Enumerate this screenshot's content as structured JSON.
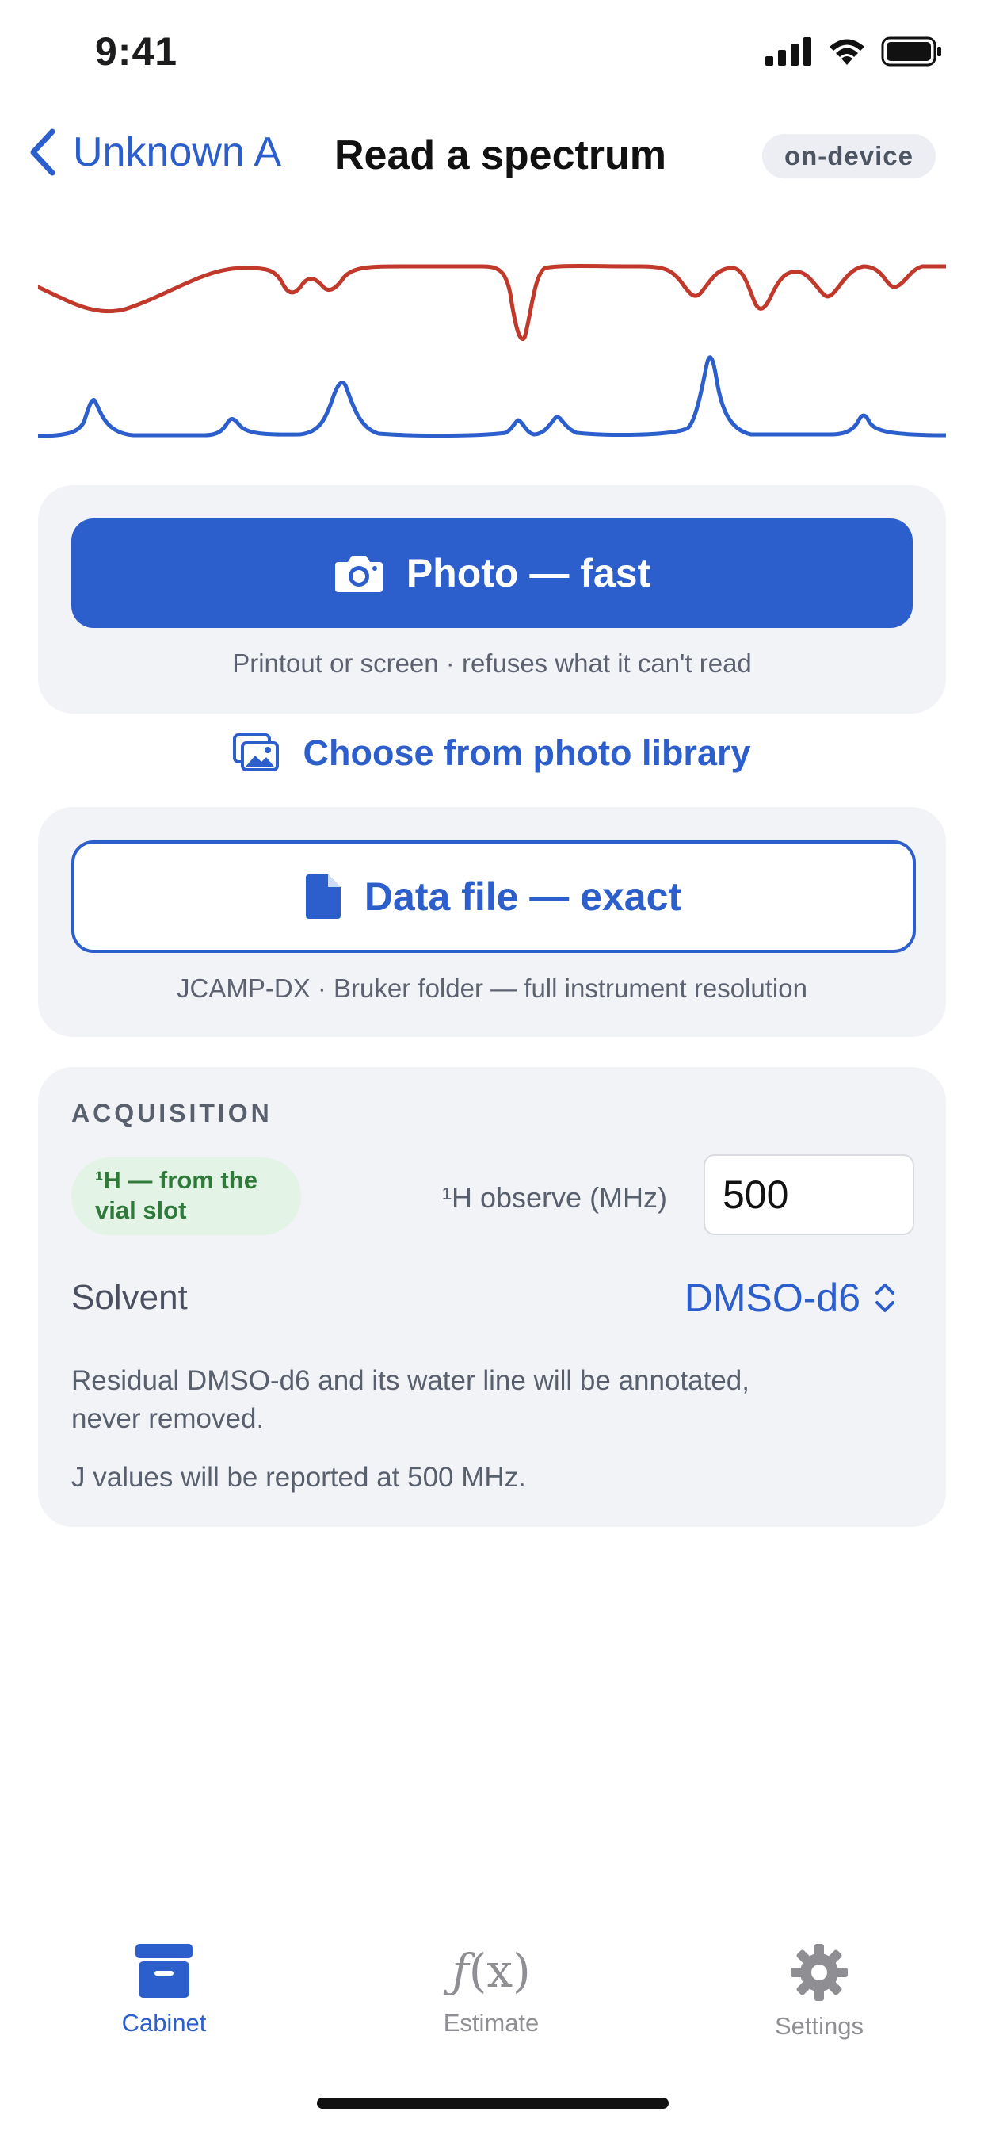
{
  "status_bar": {
    "time": "9:41"
  },
  "nav": {
    "back_label": "Unknown A",
    "title": "Read a spectrum",
    "badge": "on-device"
  },
  "photo_card": {
    "button_label": "Photo — fast",
    "caption": "Printout or screen · refuses what it can't read"
  },
  "library_link": {
    "label": "Choose from photo library"
  },
  "file_card": {
    "button_label": "Data file — exact",
    "caption": "JCAMP-DX · Bruker folder — full instrument resolution"
  },
  "acquisition": {
    "heading": "ACQUISITION",
    "nucleus_pill_line1": "¹H — from the",
    "nucleus_pill_line2": "vial slot",
    "observe_label": "¹H observe (MHz)",
    "observe_value": "500",
    "solvent_label": "Solvent",
    "solvent_value": "DMSO-d6",
    "note_residual_line1": "Residual DMSO-d6 and its water line will be annotated,",
    "note_residual_line2": "never removed.",
    "note_j": "J values will be reported at 500 MHz."
  },
  "tabs": [
    {
      "label": "Cabinet",
      "icon": "archive-box-icon",
      "selected": true
    },
    {
      "label": "Estimate",
      "icon": "function-fx-icon",
      "selected": false
    },
    {
      "label": "Settings",
      "icon": "gear-icon",
      "selected": false
    }
  ],
  "colors": {
    "accent": "#2c5fcc",
    "ir_trace": "#c0392b",
    "nmr_trace": "#2c5fcc",
    "card_bg": "#f2f3f7",
    "pill_bg": "#e3f3e5",
    "pill_text": "#2f7a3a",
    "tab_inactive": "#8e8e93"
  }
}
